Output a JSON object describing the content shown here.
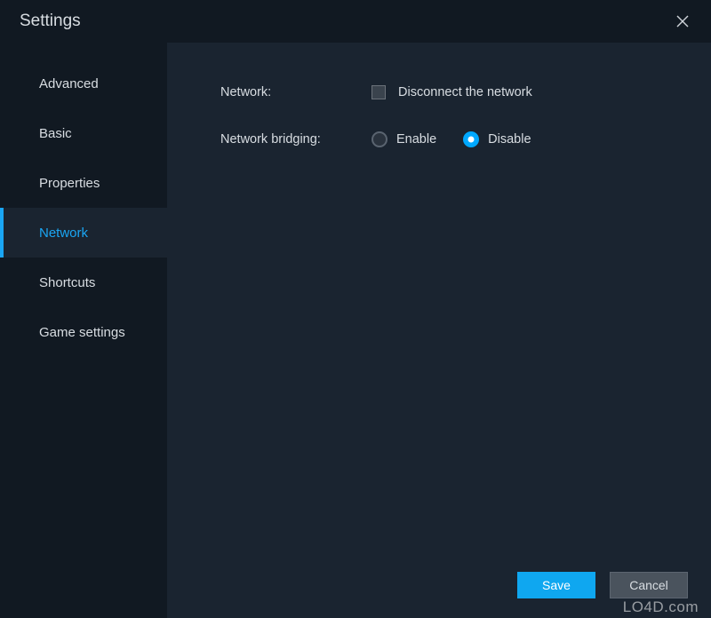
{
  "window": {
    "title": "Settings"
  },
  "sidebar": {
    "items": [
      {
        "label": "Advanced",
        "active": false
      },
      {
        "label": "Basic",
        "active": false
      },
      {
        "label": "Properties",
        "active": false
      },
      {
        "label": "Network",
        "active": true
      },
      {
        "label": "Shortcuts",
        "active": false
      },
      {
        "label": "Game settings",
        "active": false
      }
    ]
  },
  "form": {
    "network_label": "Network:",
    "network_checkbox_label": "Disconnect the network",
    "bridging_label": "Network bridging:",
    "bridging_enable": "Enable",
    "bridging_disable": "Disable"
  },
  "buttons": {
    "save": "Save",
    "cancel": "Cancel"
  },
  "watermark": "LO4D.com"
}
